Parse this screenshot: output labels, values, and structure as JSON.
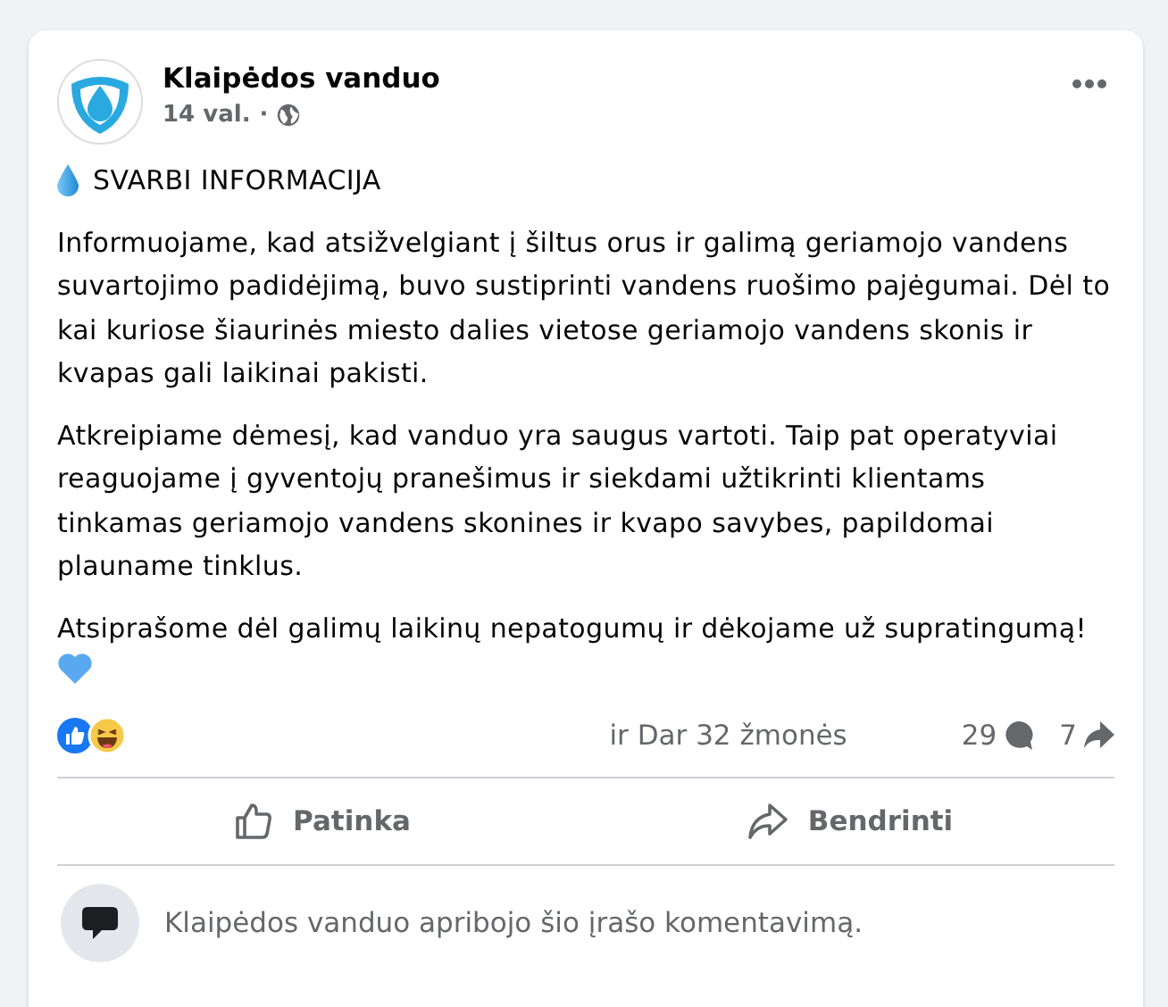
{
  "post": {
    "author": "Klaipėdos vanduo",
    "time": "14 val.",
    "separator": "·",
    "heading": "SVARBI INFORMACIJA",
    "paragraphs": [
      "Informuojame, kad atsižvelgiant į šiltus orus ir galimą geriamojo vandens suvartojimo padidėjimą, buvo sustiprinti vandens ruošimo pajėgumai. Dėl to kai kuriose šiaurinės miesto dalies vietose geriamojo vandens skonis ir kvapas gali laikinai pakisti.",
      "Atkreipiame dėmesį, kad vanduo yra saugus vartoti. Taip pat operatyviai reaguojame į gyventojų pranešimus ir siekdami užtikrinti klientams tinkamas geriamojo vandens skonines ir kvapo savybes, papildomai plauname tinklus.",
      "Atsiprašome dėl galimų laikinų nepatogumų ir dėkojame už supratingumą!"
    ]
  },
  "reactions": {
    "summary": "ir Dar 32 žmonės",
    "comments": "29",
    "shares": "7"
  },
  "actions": [
    {
      "kind": "like",
      "label": "Patinka"
    },
    {
      "kind": "share",
      "label": "Bendrinti"
    }
  ],
  "comment_notice": "Klaipėdos vanduo apribojo šio įrašo komentavimą."
}
